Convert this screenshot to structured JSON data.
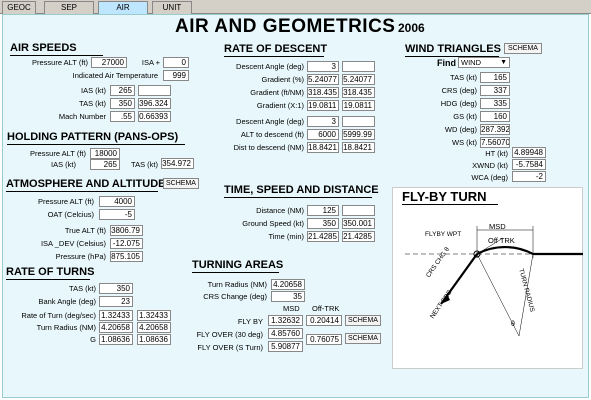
{
  "tabs": [
    {
      "label": "GEOC"
    },
    {
      "label": "SEP"
    },
    {
      "label": "AIR"
    },
    {
      "label": "UNIT"
    }
  ],
  "header": {
    "title": "AIR AND GEOMETRICS",
    "year": "2006"
  },
  "air_speeds": {
    "heading": "AIR SPEEDS",
    "pressure_alt_label": "Pressure ALT (ft)",
    "pressure_alt": "27000",
    "isa_label": "ISA +",
    "isa": "0",
    "iat_label": "Indicated Air Temperature",
    "iat": "999",
    "ias_label": "IAS (kt)",
    "ias": "265",
    "tas_label": "TAS (kt)",
    "tas_in": "350",
    "tas_out": "396.324",
    "mach_label": "Mach Number",
    "mach_in": ".55",
    "mach_out": "0.66393"
  },
  "holding": {
    "heading": "HOLDING PATTERN (PANS-OPS)",
    "pressure_alt_label": "Pressure ALT (ft)",
    "pressure_alt": "18000",
    "ias_label": "IAS (kt)",
    "ias": "265",
    "tas_label": "TAS (kt)",
    "tas": "354.972"
  },
  "atmosphere": {
    "heading": "ATMOSPHERE AND ALTITUDE",
    "schema": "SCHEMA",
    "pressure_alt_label": "Pressure ALT (ft)",
    "pressure_alt": "4000",
    "oat_label": "OAT (Celcius)",
    "oat": "-5",
    "true_alt_label": "True ALT (ft)",
    "true_alt": "3806.79",
    "isa_dev_label": "ISA _DEV (Celsius)",
    "isa_dev": "-12.075",
    "pressure_label": "Pressure (hPa)",
    "pressure": "875.105"
  },
  "turns": {
    "heading": "RATE OF TURNS",
    "tas_label": "TAS (kt)",
    "tas": "350",
    "bank_label": "Bank Angle (deg)",
    "bank": "23",
    "rate_label": "Rate of Turn (deg/sec)",
    "rate_a": "1.32433",
    "rate_b": "1.32433",
    "radius_label": "Turn Radius (NM)",
    "radius_a": "4.20658",
    "radius_b": "4.20658",
    "g_label": "G",
    "g_a": "1.08636",
    "g_b": "1.08636"
  },
  "descent": {
    "heading": "RATE OF DESCENT",
    "angle_label": "Descent Angle (deg)",
    "angle": "3",
    "grad_pct_label": "Gradient (%)",
    "grad_pct_a": "5.24077",
    "grad_pct_b": "5.24077",
    "grad_ftnm_label": "Gradient (ft/NM)",
    "grad_ftnm_a": "318.435",
    "grad_ftnm_b": "318.435",
    "grad_x1_label": "Gradient (X:1)",
    "grad_x1_a": "19.0811",
    "grad_x1_b": "19.0811",
    "angle2_label": "Descent Angle (deg)",
    "angle2": "3",
    "alt_label": "ALT to descend (ft)",
    "alt_a": "6000",
    "alt_b": "5999.99",
    "dist_label": "Dist to descend (NM)",
    "dist_a": "18.8421",
    "dist_b": "18.8421"
  },
  "tsd": {
    "heading": "TIME, SPEED AND DISTANCE",
    "distance_label": "Distance (NM)",
    "distance": "125",
    "gs_label": "Ground Speed (kt)",
    "gs_a": "350",
    "gs_b": "350.001",
    "time_label": "Time (min)",
    "time_a": "21.4285",
    "time_b": "21.4285"
  },
  "turning_areas": {
    "heading": "TURNING AREAS",
    "radius_label": "Turn Radius (NM)",
    "radius": "4.20658",
    "crs_label": "CRS Change (deg)",
    "crs": "35",
    "msd_col": "MSD",
    "offtrk_col": "Off-TRK",
    "flyby_label": "FLY BY",
    "flyby_msd": "1.32632",
    "flyby_off": "0.20414",
    "flyover30_label": "FLY OVER (30 deg)",
    "flyover30_msd": "4.85760",
    "flyovers_label": "FLY OVER (S Turn)",
    "flyovers_msd": "5.90877",
    "flyovers_off": "0.76075",
    "schema": "SCHEMA"
  },
  "wind": {
    "heading": "WIND TRIANGLES",
    "schema": "SCHEMA",
    "find_label": "Find",
    "find_value": "WIND",
    "tas_label": "TAS (kt)",
    "tas": "165",
    "crs_label": "CRS (deg)",
    "crs": "337",
    "hdg_label": "HDG (deg)",
    "hdg": "335",
    "gs_label": "GS (kt)",
    "gs": "160",
    "wd_label": "WD (deg)",
    "wd": "287.392",
    "ws_label": "WS (kt)",
    "ws": "7.56070",
    "ht_label": "HT (kt)",
    "ht": "4.89948",
    "xwnd_label": "XWND (kt)",
    "xwnd": "-5.7584",
    "wca_label": "WCA (deg)",
    "wca": "-2"
  },
  "flyby_diagram": {
    "title": "FLY-BY TURN",
    "msd": "MSD",
    "off_trk": "Off TRK",
    "flyby_wpt": "FLYBY WPT",
    "crs_chg": "CRS CHG θ",
    "next_crs": "NEXT CRS",
    "turn_radius": "TURN RADIUS",
    "theta": "θ"
  },
  "colors": {
    "panel_bg": "#e8f7fb",
    "active_tab": "#bfe6ff"
  }
}
